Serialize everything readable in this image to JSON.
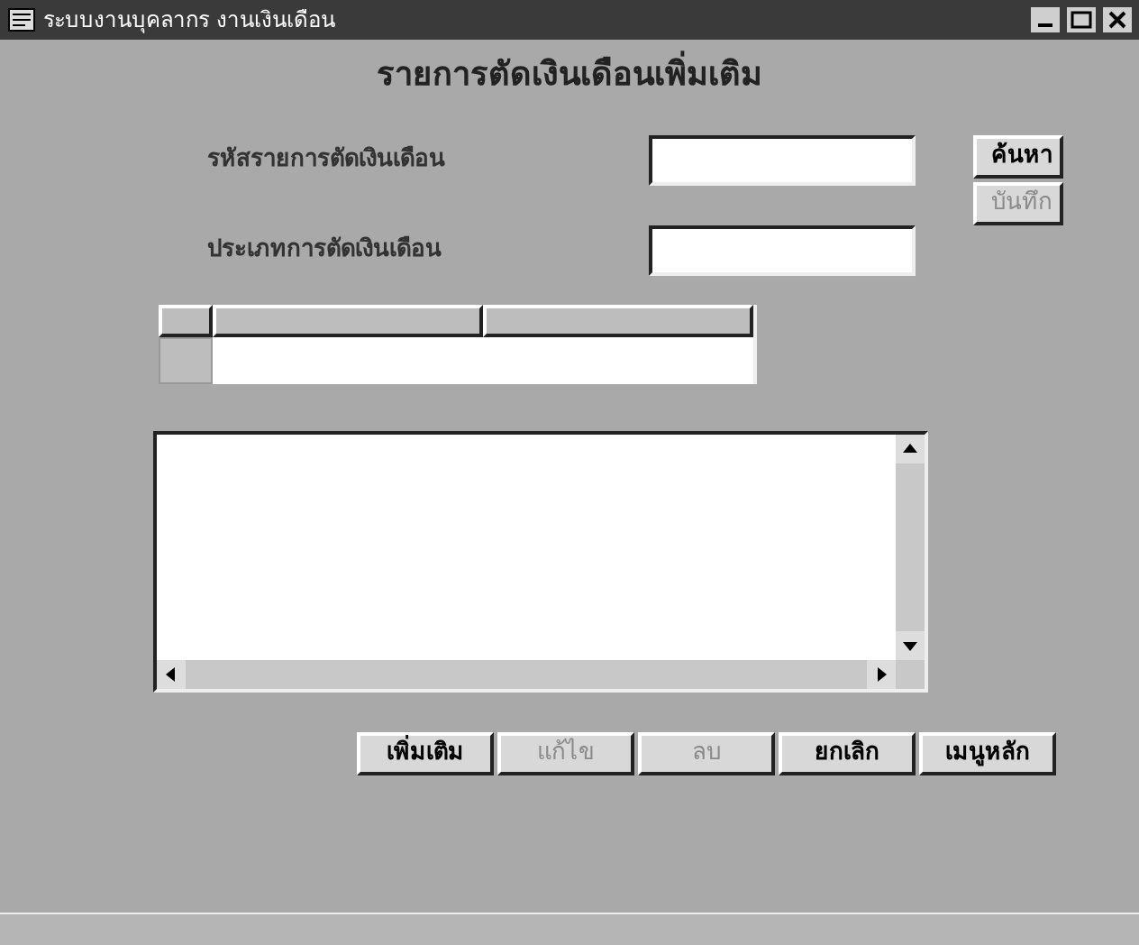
{
  "window": {
    "title": "ระบบงานบุคลากร งานเงินเดือน"
  },
  "heading": "รายการตัดเงินเดือนเพิ่มเติม",
  "fields": [
    {
      "label": "รหัสรายการตัดเงินเดือน"
    },
    {
      "label": "ประเภทการตัดเงินเดือน"
    }
  ],
  "side_buttons": [
    {
      "label": "ค้นหา",
      "disabled": false
    },
    {
      "label": "บันทึก",
      "disabled": true
    }
  ],
  "buttons": [
    {
      "label": "เพิ่มเติม",
      "disabled": false
    },
    {
      "label": "แก้ไข",
      "disabled": true
    },
    {
      "label": "ลบ",
      "disabled": true
    },
    {
      "label": "ยกเลิก",
      "disabled": false
    },
    {
      "label": "เมนูหลัก",
      "disabled": false
    }
  ]
}
